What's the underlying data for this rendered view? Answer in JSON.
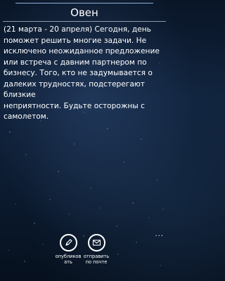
{
  "page": {
    "title": "Овен",
    "horoscope_text": "(21 марта - 20 апреля) Сегодня, день\nпоможет решить многие задачи. Не\nисключено неожиданное предложение\nили встреча с давним партнером по\nбизнесу. Того, кто не задумывается о\nдалеких трудностях, подстерегают близкие\nнеприятности. Будьте осторожны с\nсамолетом."
  },
  "appbar": {
    "publish_label": "опубликов\nать",
    "publish_icon": "pencil-icon",
    "email_label": "отправить\nпо почте",
    "email_icon": "envelope-icon",
    "more_label": "..."
  }
}
